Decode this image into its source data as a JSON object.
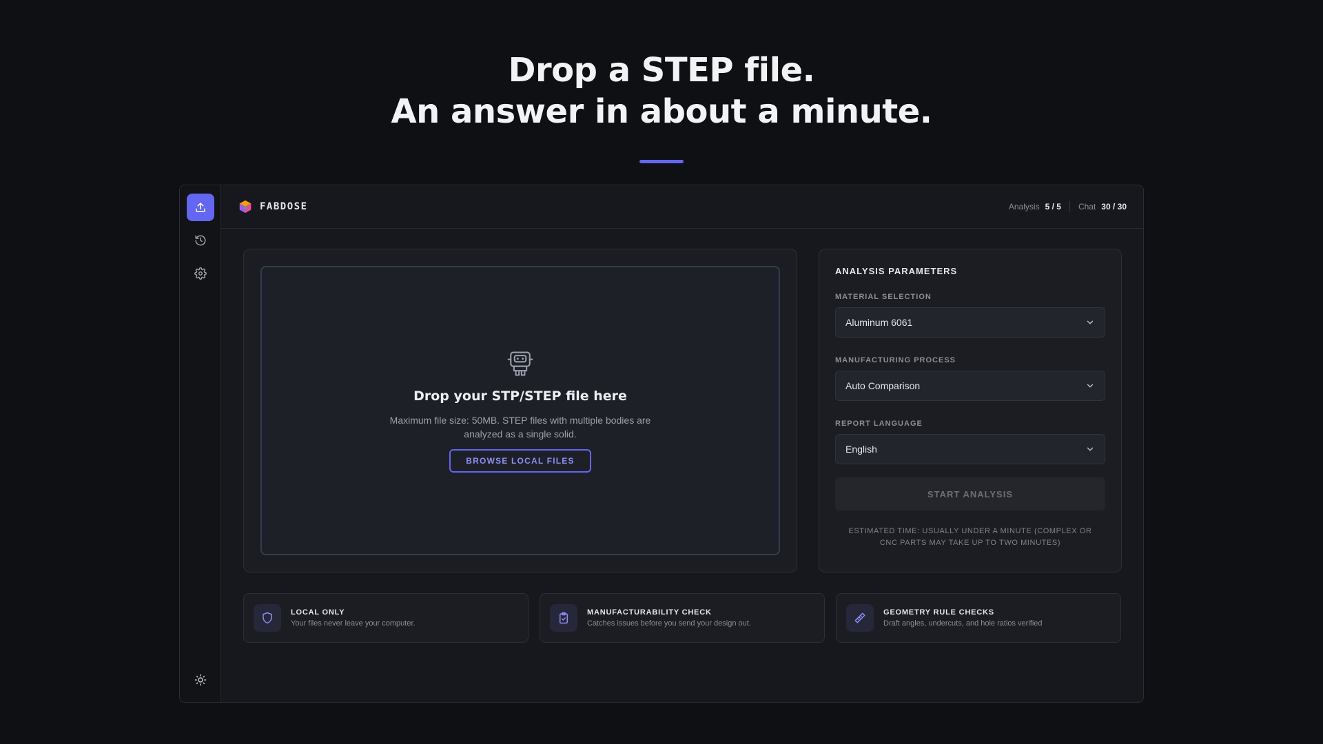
{
  "hero": {
    "line1": "Drop a STEP file.",
    "line2": "An answer in about a minute."
  },
  "colors": {
    "accent": "#6366f1",
    "background": "#0f1013",
    "panel": "#1b1d22"
  },
  "sidebar": {
    "items": [
      {
        "icon": "upload-icon",
        "active": true
      },
      {
        "icon": "history-icon",
        "active": false
      },
      {
        "icon": "gear-icon",
        "active": false
      }
    ],
    "bottom_icon": "sun-icon"
  },
  "header": {
    "brand": "FABDOSE",
    "analysis_label": "Analysis",
    "analysis_value": "5 / 5",
    "chat_label": "Chat",
    "chat_value": "30 / 30"
  },
  "dropzone": {
    "title": "Drop your STP/STEP file here",
    "description": "Maximum file size: 50MB. STEP files with multiple bodies are analyzed as a single solid.",
    "browse_label": "BROWSE LOCAL FILES"
  },
  "params": {
    "title": "ANALYSIS PARAMETERS",
    "material_label": "MATERIAL SELECTION",
    "material_value": "Aluminum 6061",
    "process_label": "MANUFACTURING PROCESS",
    "process_value": "Auto Comparison",
    "language_label": "REPORT LANGUAGE",
    "language_value": "English",
    "start_label": "START ANALYSIS",
    "estimate": "ESTIMATED TIME: USUALLY UNDER A MINUTE (COMPLEX OR CNC PARTS MAY TAKE UP TO TWO MINUTES)"
  },
  "features": [
    {
      "icon": "shield-icon",
      "title": "LOCAL ONLY",
      "desc": "Your files never leave your computer."
    },
    {
      "icon": "clipboard-check-icon",
      "title": "MANUFACTURABILITY CHECK",
      "desc": "Catches issues before you send your design out."
    },
    {
      "icon": "ruler-icon",
      "title": "GEOMETRY RULE CHECKS",
      "desc": "Draft angles, undercuts, and hole ratios verified"
    }
  ]
}
